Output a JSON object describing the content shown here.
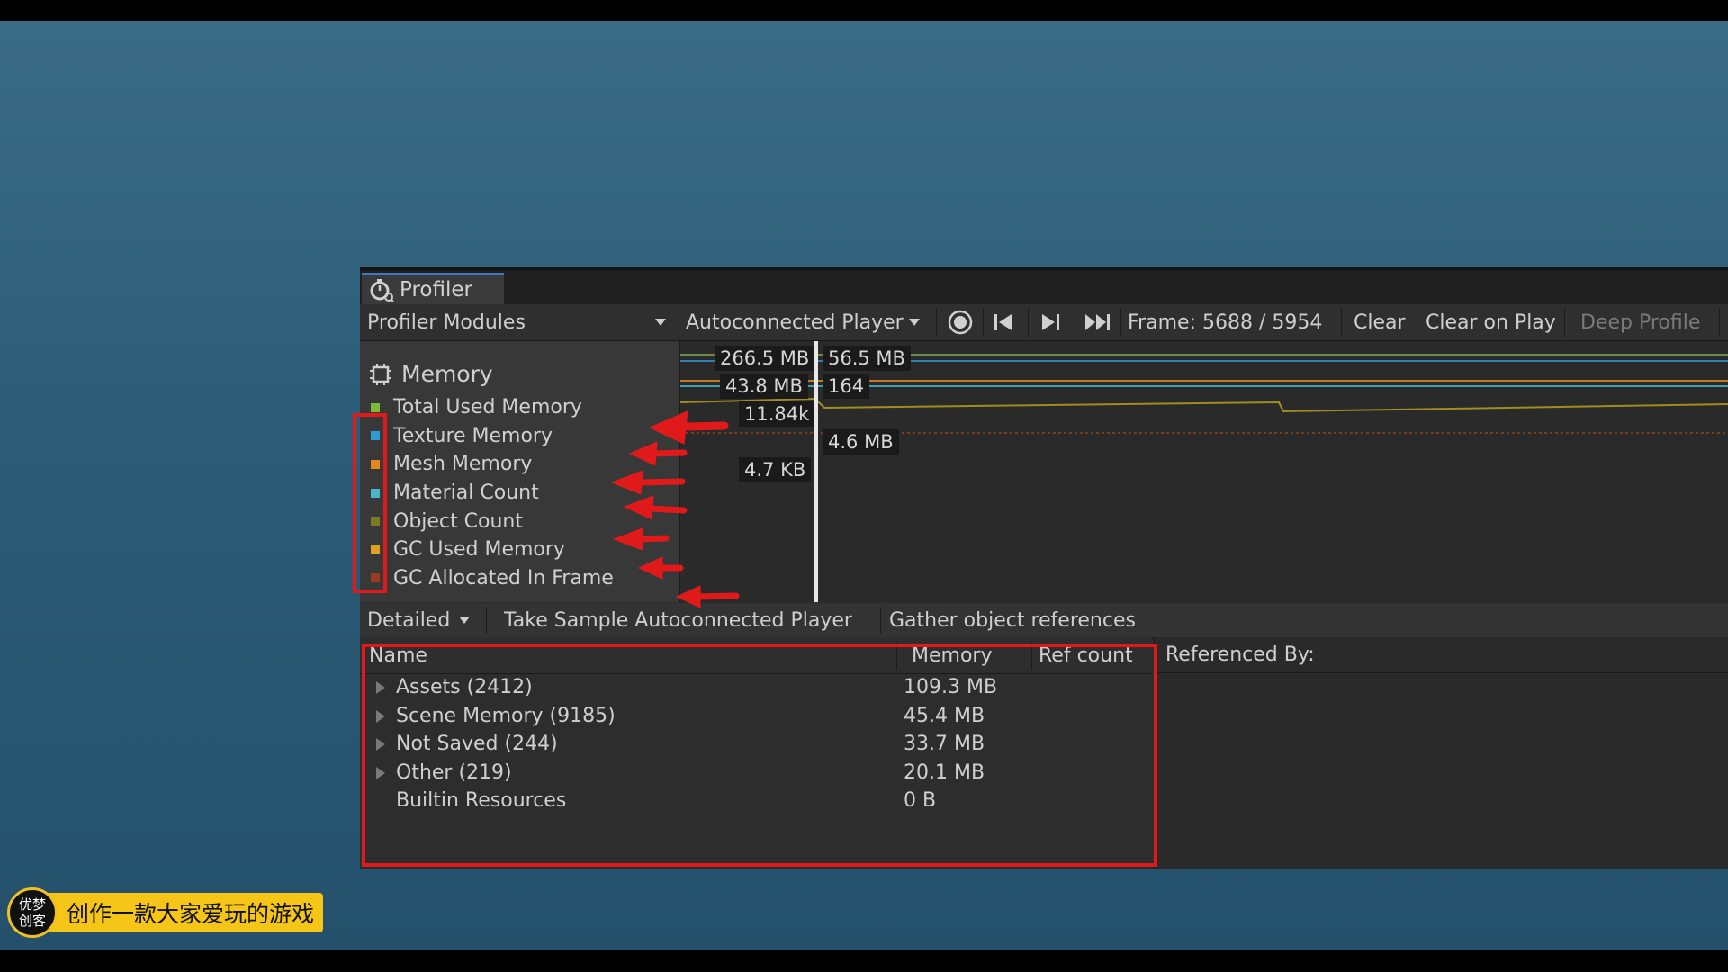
{
  "window": {
    "tab_title": "Profiler"
  },
  "toolbar": {
    "modules_label": "Profiler Modules",
    "player_label": "Autoconnected Player",
    "frame_text": "Frame: 5688 / 5954",
    "clear": "Clear",
    "clear_on_play": "Clear on Play",
    "deep_profile": "Deep Profile"
  },
  "module": {
    "title": "Memory",
    "legend": [
      {
        "label": "Total Used Memory",
        "color": "#7dba3a"
      },
      {
        "label": "Texture Memory",
        "color": "#2f9bd6"
      },
      {
        "label": "Mesh Memory",
        "color": "#e5861e"
      },
      {
        "label": "Material Count",
        "color": "#48b8c8"
      },
      {
        "label": "Object Count",
        "color": "#7a7a1e"
      },
      {
        "label": "GC Used Memory",
        "color": "#e0a020"
      },
      {
        "label": "GC Allocated In Frame",
        "color": "#9a3a22"
      }
    ]
  },
  "graph_labels": {
    "l1": "266.5 MB",
    "l2": "56.5 MB",
    "l3": "43.8 MB",
    "l4": "164",
    "l5": "11.84k",
    "l6": "4.6 MB",
    "l7": "4.7 KB"
  },
  "detail": {
    "view_label": "Detailed",
    "take_sample": "Take Sample Autoconnected Player",
    "gather_refs": "Gather object references",
    "columns": {
      "name": "Name",
      "memory": "Memory",
      "ref_count": "Ref count",
      "referenced_by": "Referenced By:"
    },
    "rows": [
      {
        "name": "Assets (2412)",
        "memory": "109.3 MB",
        "expandable": true
      },
      {
        "name": "Scene Memory (9185)",
        "memory": "45.4 MB",
        "expandable": true
      },
      {
        "name": "Not Saved (244)",
        "memory": "33.7 MB",
        "expandable": true
      },
      {
        "name": "Other (219)",
        "memory": "20.1 MB",
        "expandable": true
      },
      {
        "name": "Builtin Resources",
        "memory": "0 B",
        "expandable": false
      }
    ]
  },
  "badge": {
    "logo_text": "优梦\n创客",
    "caption": "创作一款大家爱玩的游戏"
  }
}
